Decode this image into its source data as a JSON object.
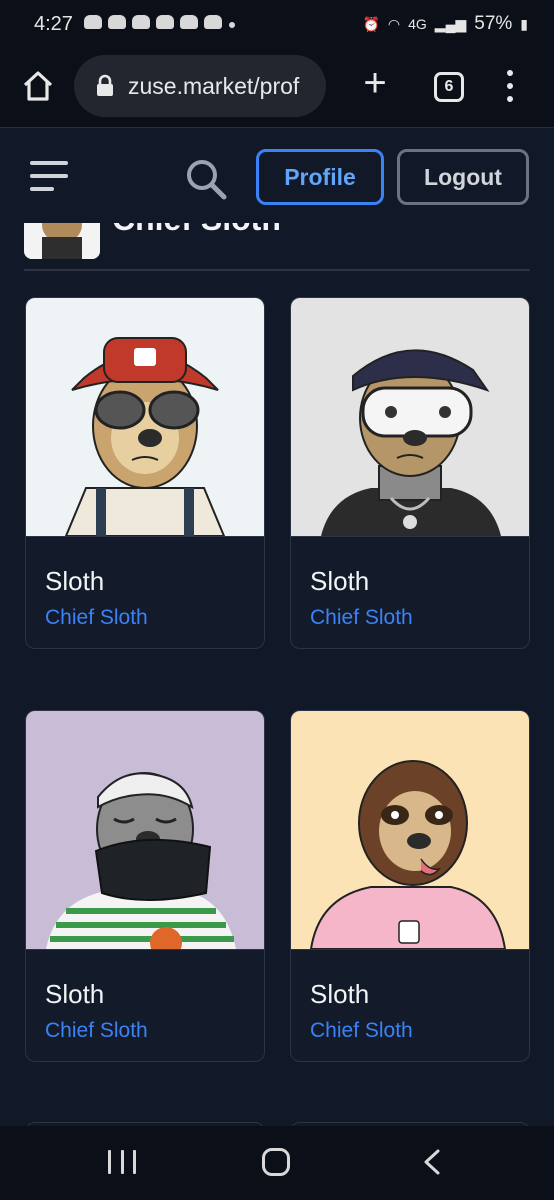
{
  "status_bar": {
    "time": "4:27",
    "network": "4G",
    "battery": "57%"
  },
  "browser": {
    "url": "zuse.market/prof",
    "tab_count": "6"
  },
  "header": {
    "profile_label": "Profile",
    "logout_label": "Logout"
  },
  "collection": {
    "title": "Chief Sloth"
  },
  "cards": [
    {
      "name": "Sloth",
      "collection": "Chief Sloth",
      "bg": "#eef4f5",
      "accent": "#c0392b"
    },
    {
      "name": "Sloth",
      "collection": "Chief Sloth",
      "bg": "#e3e3e3",
      "accent": "#2d2f4a"
    },
    {
      "name": "Sloth",
      "collection": "Chief Sloth",
      "bg": "#c8bcd7",
      "accent": "#1f2328"
    },
    {
      "name": "Sloth",
      "collection": "Chief Sloth",
      "bg": "#fbe3b5",
      "accent": "#f4b6c8"
    }
  ],
  "colors": {
    "page_bg": "#111827",
    "primary": "#3b82f6",
    "card_border": "#2b3344"
  }
}
